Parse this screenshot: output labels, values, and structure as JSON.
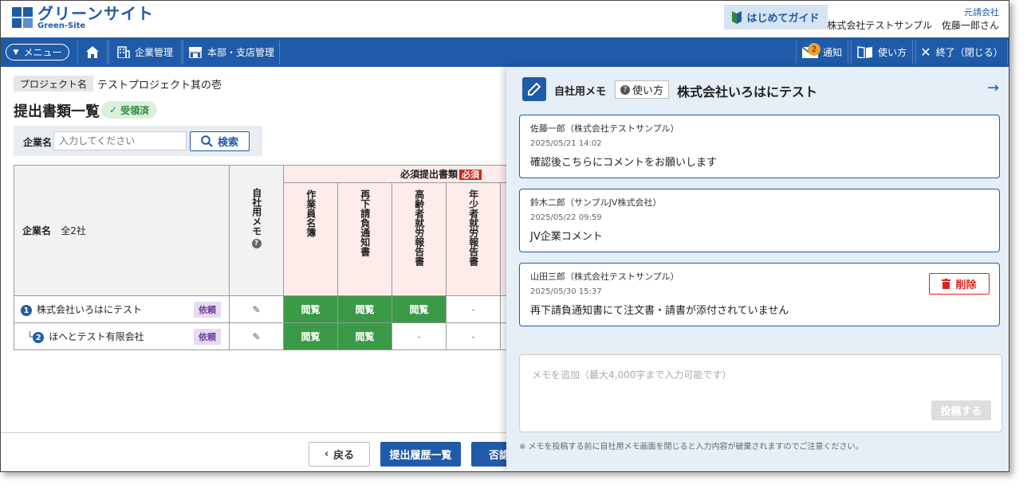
{
  "header": {
    "logo_ja": "グリーンサイト",
    "logo_en": "Green-Site",
    "guide_label": "はじめてガイド",
    "role": "元請会社",
    "company": "株式会社テストサンプル",
    "user": "佐藤一郎さん"
  },
  "nav": {
    "menu_label": "メニュー",
    "home_icon": "home-icon",
    "company_mgmt": "企業管理",
    "branch_mgmt": "本部・支店管理",
    "notify_label": "通知",
    "notify_count": "2",
    "usage_label": "使い方",
    "close_label": "終了（閉じる）"
  },
  "project": {
    "label": "プロジェクト名",
    "value": "テストプロジェクト其の壱"
  },
  "page": {
    "title": "提出書類一覧",
    "status": "受領済"
  },
  "search": {
    "label": "企業名",
    "placeholder": "入力してください",
    "button": "検索"
  },
  "table": {
    "company_header": "企業名",
    "company_count": "全2社",
    "memo_header": "自社用メモ",
    "required_header": "必須提出書類",
    "required_tag": "必須",
    "doc_headers": [
      "作業員名簿",
      "再下請負通知書",
      "高齢者就労報告書",
      "年少者就労報告書"
    ],
    "rows": [
      {
        "num": "1",
        "prefix": "",
        "name": "株式会社いろはにテスト",
        "badge": "依頼",
        "cells": [
          "閲覧",
          "閲覧",
          "閲覧",
          "-"
        ]
      },
      {
        "num": "2",
        "prefix": "└",
        "name": "ほへとテスト有限会社",
        "badge": "依頼",
        "cells": [
          "閲覧",
          "閲覧",
          "-",
          "-"
        ]
      }
    ]
  },
  "footer": {
    "back": "戻る",
    "history": "提出履歴一覧",
    "reject": "否認"
  },
  "memo": {
    "title": "自社用メモ",
    "usage": "使い方",
    "company": "株式会社いろはにテスト",
    "entries": [
      {
        "author": "佐藤一郎（株式会社テストサンプル）",
        "date": "2025/05/21 14:02",
        "body": "確認後こちらにコメントをお願いします"
      },
      {
        "author": "鈴木二郎（サンプルJV株式会社）",
        "date": "2025/05/22 09:59",
        "body": "JV企業コメント"
      },
      {
        "author": "山田三郎（株式会社テストサンプル）",
        "date": "2025/05/30 15:37",
        "body": "再下請負通知書にて注文書・請書が添付されていません",
        "delete": "削除"
      }
    ],
    "placeholder": "メモを追加（最大4,000字まで入力可能です）",
    "post": "投稿する",
    "note": "※ メモを投稿する前に自社用メモ画面を閉じると入力内容が破棄されますのでご注意ください。"
  },
  "colors": {
    "brand": "#1f5ba8",
    "view_cell": "#3a9a47",
    "required_bg": "#fdecea",
    "danger": "#d8241b"
  }
}
